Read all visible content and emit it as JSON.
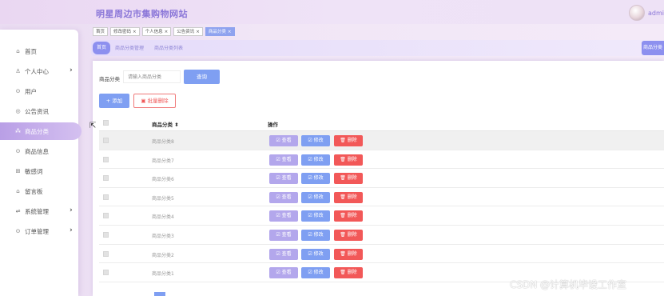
{
  "header": {
    "site_title": "明星周边市集购物网站",
    "user_name": "admin"
  },
  "sidebar": {
    "items": [
      {
        "label": "首页",
        "icon": "home-icon",
        "glyph": "⌂",
        "has_arrow": false
      },
      {
        "label": "个人中心",
        "icon": "user-icon",
        "glyph": "♙",
        "has_arrow": true
      },
      {
        "label": "用户",
        "icon": "user-circle-icon",
        "glyph": "⊙",
        "has_arrow": false
      },
      {
        "label": "公告资讯",
        "icon": "notice-icon",
        "glyph": "◎",
        "has_arrow": false
      },
      {
        "label": "商品分类",
        "icon": "category-icon",
        "glyph": "⁂",
        "has_arrow": false,
        "active": true
      },
      {
        "label": "商品信息",
        "icon": "goods-icon",
        "glyph": "⊙",
        "has_arrow": false
      },
      {
        "label": "敏感词",
        "icon": "keyword-icon",
        "glyph": "⊞",
        "has_arrow": false
      },
      {
        "label": "留言板",
        "icon": "message-icon",
        "glyph": "⌂",
        "has_arrow": false
      },
      {
        "label": "系统管理",
        "icon": "system-icon",
        "glyph": "⇌",
        "has_arrow": true
      },
      {
        "label": "订单管理",
        "icon": "order-icon",
        "glyph": "⊙",
        "has_arrow": true
      }
    ],
    "arrow": "›"
  },
  "tags": [
    {
      "label": "首页",
      "closable": false
    },
    {
      "label": "修改密码",
      "closable": true
    },
    {
      "label": "个人信息",
      "closable": true
    },
    {
      "label": "公告资讯",
      "closable": true
    },
    {
      "label": "商品分类",
      "closable": true,
      "active": true
    }
  ],
  "tag_close": "×",
  "breadcrumb": {
    "home": "首页",
    "level1": "商品分类管理",
    "level2": "商品分类列表",
    "right_label": "商品分类"
  },
  "search": {
    "label": "商品分类",
    "placeholder": "请输入商品分类",
    "button": "查询"
  },
  "actions": {
    "add": "+ 添加",
    "batch_delete": "▣ 批量删除"
  },
  "table": {
    "col_name": "商品分类 ⬍",
    "col_ops": "操作",
    "rows": [
      "商品分类8",
      "商品分类7",
      "商品分类6",
      "商品分类5",
      "商品分类4",
      "商品分类3",
      "商品分类2",
      "商品分类1"
    ],
    "btn_view": "☑ 查看",
    "btn_edit": "☑ 修改",
    "btn_delete": "🗑 删除"
  },
  "watermark": "CSDN @计算机毕设工作室"
}
